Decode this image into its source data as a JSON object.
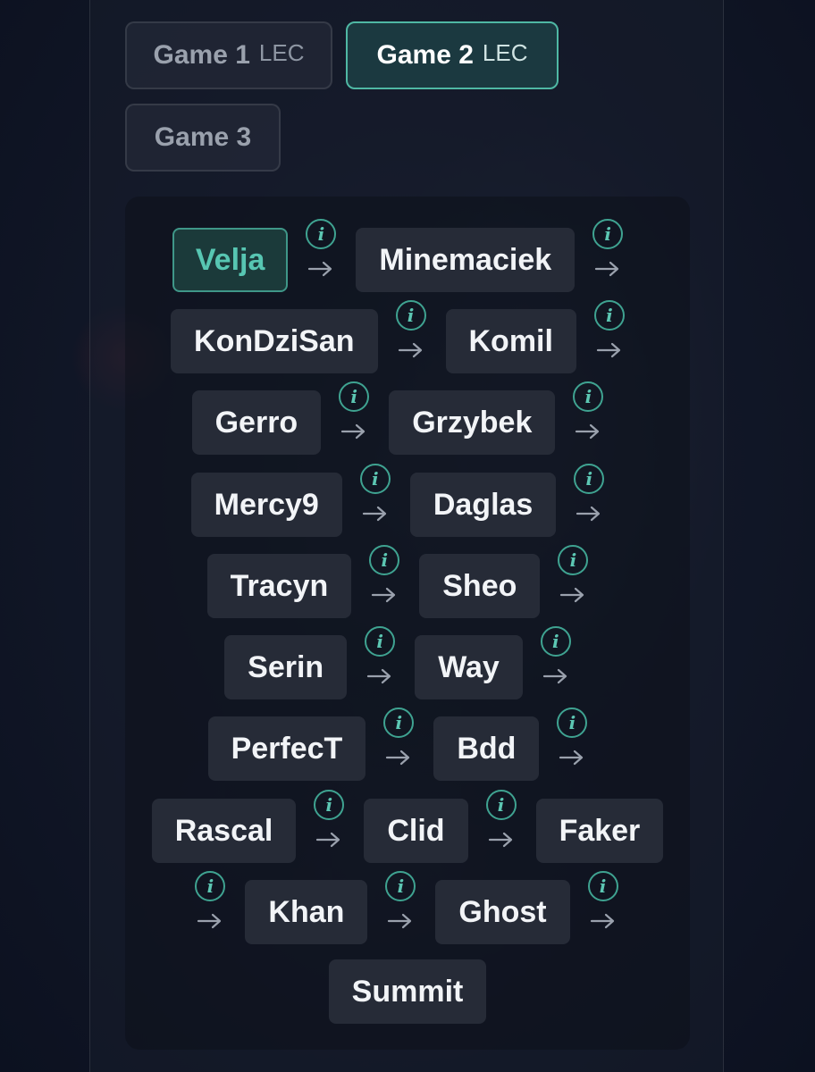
{
  "tabs": [
    {
      "label": "Game 1",
      "tag": "LEC",
      "active": false
    },
    {
      "label": "Game 2",
      "tag": "LEC",
      "active": true
    },
    {
      "label": "Game 3",
      "tag": "",
      "active": false
    }
  ],
  "chain": {
    "players": [
      "Velja",
      "Minemaciek",
      "KonDziSan",
      "Komil",
      "Gerro",
      "Grzybek",
      "Mercy9",
      "Daglas",
      "Tracyn",
      "Sheo",
      "Serin",
      "Way",
      "PerfecT",
      "Bdd",
      "Rascal",
      "Clid",
      "Faker",
      "Khan",
      "Ghost",
      "Summit"
    ],
    "active_player": "Velja",
    "info_glyph": "i",
    "icons": {
      "info": "info-icon",
      "arrow": "arrow-right-icon"
    }
  },
  "colors": {
    "accent": "#4fb8a4",
    "chip": "#262b37",
    "background": "#121828"
  }
}
